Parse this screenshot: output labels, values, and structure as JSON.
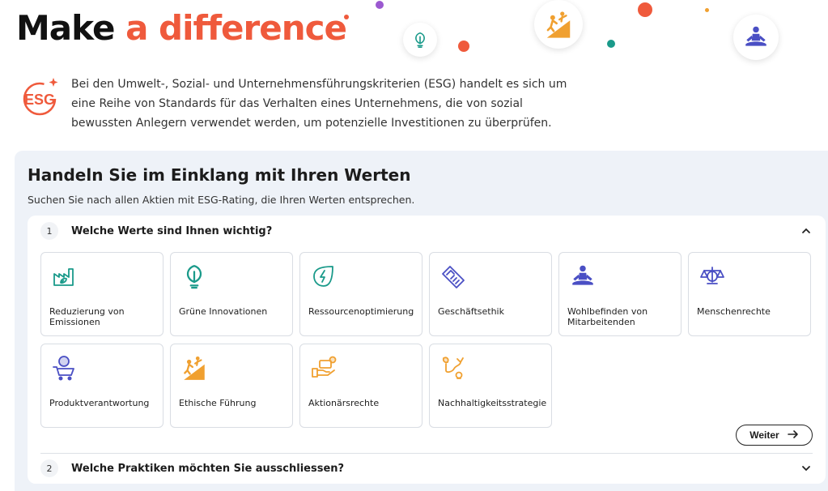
{
  "hero": {
    "title_part1": "Make",
    "title_part2": "a difference"
  },
  "intro": {
    "logo_icon": "esg-logo-icon",
    "text": "Bei den Umwelt-, Sozial- und Unternehmensführungskriterien (ESG) handelt es sich um eine Reihe von Standards für das Verhalten eines Unternehmens, die von sozial bewussten Anlegern verwendet werden, um potenzielle Investitionen zu überprüfen."
  },
  "panel": {
    "title": "Handeln Sie im Einklang mit Ihren Werten",
    "subtitle": "Suchen Sie nach allen Aktien mit ESG-Rating, die Ihren Werten entsprechen."
  },
  "step1": {
    "number": "1",
    "label": "Welche Werte sind Ihnen wichtig?"
  },
  "step2": {
    "number": "2",
    "label": "Welche Praktiken möchten Sie ausschliessen?"
  },
  "values": [
    {
      "label": "Reduzierung von Emissionen",
      "icon": "factory-leaf-icon",
      "color": "#1a9a8a"
    },
    {
      "label": "Grüne Innovationen",
      "icon": "leaf-bulb-icon",
      "color": "#1a9a8a"
    },
    {
      "label": "Ressourcenoptimierung",
      "icon": "energy-leaf-icon",
      "color": "#1a9a8a"
    },
    {
      "label": "Geschäftsethik",
      "icon": "handshake-icon",
      "color": "#4a4fc4"
    },
    {
      "label": "Wohlbefinden von Mitarbeitenden",
      "icon": "meditation-icon",
      "color": "#4a4fc4"
    },
    {
      "label": "Menschenrechte",
      "icon": "scales-icon",
      "color": "#4a4fc4"
    },
    {
      "label": "Produktverantwortung",
      "icon": "globe-cart-icon",
      "color": "#4a4fc4"
    },
    {
      "label": "Ethische Führung",
      "icon": "climbing-icon",
      "color": "#f0a030"
    },
    {
      "label": "Aktionärsrechte",
      "icon": "hand-money-icon",
      "color": "#f0a030"
    },
    {
      "label": "Nachhaltigkeitsstrategie",
      "icon": "strategy-path-icon",
      "color": "#f0a030"
    }
  ],
  "next_button": {
    "label": "Weiter"
  },
  "colors": {
    "accent": "#ef5a3c",
    "teal": "#1a9a8a",
    "indigo": "#4a4fc4",
    "orange": "#f0a030",
    "panel_bg": "#eef2f8"
  }
}
